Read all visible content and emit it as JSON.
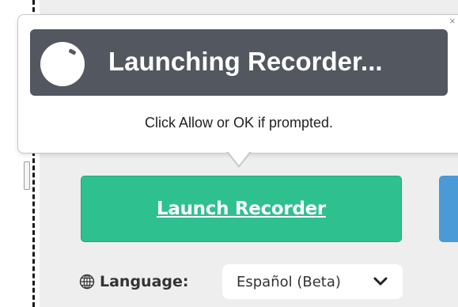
{
  "popup": {
    "title": "Launching Recorder...",
    "message": "Click Allow or OK if prompted.",
    "close_glyph": "×"
  },
  "recorder": {
    "launch_label": "Launch Recorder"
  },
  "language": {
    "label": "Language:",
    "selected": "Español (Beta)"
  },
  "icons": {
    "knob": "recorder-knob-icon",
    "globe": "globe-icon",
    "chevron": "chevron-down-icon",
    "close": "close-icon"
  },
  "colors": {
    "banner": "#525760",
    "launch_button": "#2fc08f",
    "secondary_button": "#4a9ad8",
    "panel": "#eeeeee"
  }
}
